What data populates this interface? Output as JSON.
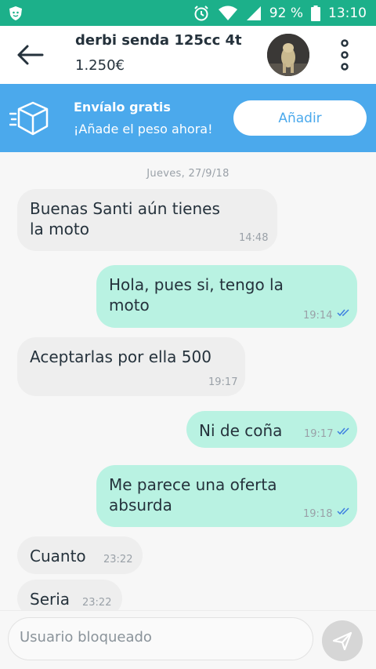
{
  "status_bar": {
    "battery": "92 %",
    "time": "13:10",
    "color": "#1cb08a"
  },
  "header": {
    "title": "derbi senda 125cc 4t",
    "price": "1.250€"
  },
  "banner": {
    "title": "Envíalo gratis",
    "subtitle": "¡Añade el peso ahora!",
    "button": "Añadir",
    "color": "#4ba9ec"
  },
  "chat": {
    "date": "Jueves, 27/9/18",
    "messages": [
      {
        "dir": "in",
        "line1": "Buenas  Santi  aún tienes",
        "line2": "la moto",
        "time": "14:48"
      },
      {
        "dir": "out",
        "line1": "Hola, pues si, tengo la",
        "line2": "moto",
        "time": "19:14",
        "read": true
      },
      {
        "dir": "in",
        "line1": "Aceptarlas por ella 500",
        "time": "19:17"
      },
      {
        "dir": "out",
        "line1": "Ni de coña",
        "time": "19:17",
        "read": true
      },
      {
        "dir": "out",
        "line1": "Me parece una oferta",
        "line2": "absurda",
        "time": "19:18",
        "read": true
      },
      {
        "dir": "in",
        "line1": "Cuanto",
        "time": "23:22"
      },
      {
        "dir": "in",
        "line1": "Seria",
        "time": "23:22"
      }
    ]
  },
  "input": {
    "placeholder": "Usuario bloqueado"
  },
  "colors": {
    "incoming": "#eeeeee",
    "outgoing": "#b9f2e2",
    "tick": "#3d7fe0"
  }
}
